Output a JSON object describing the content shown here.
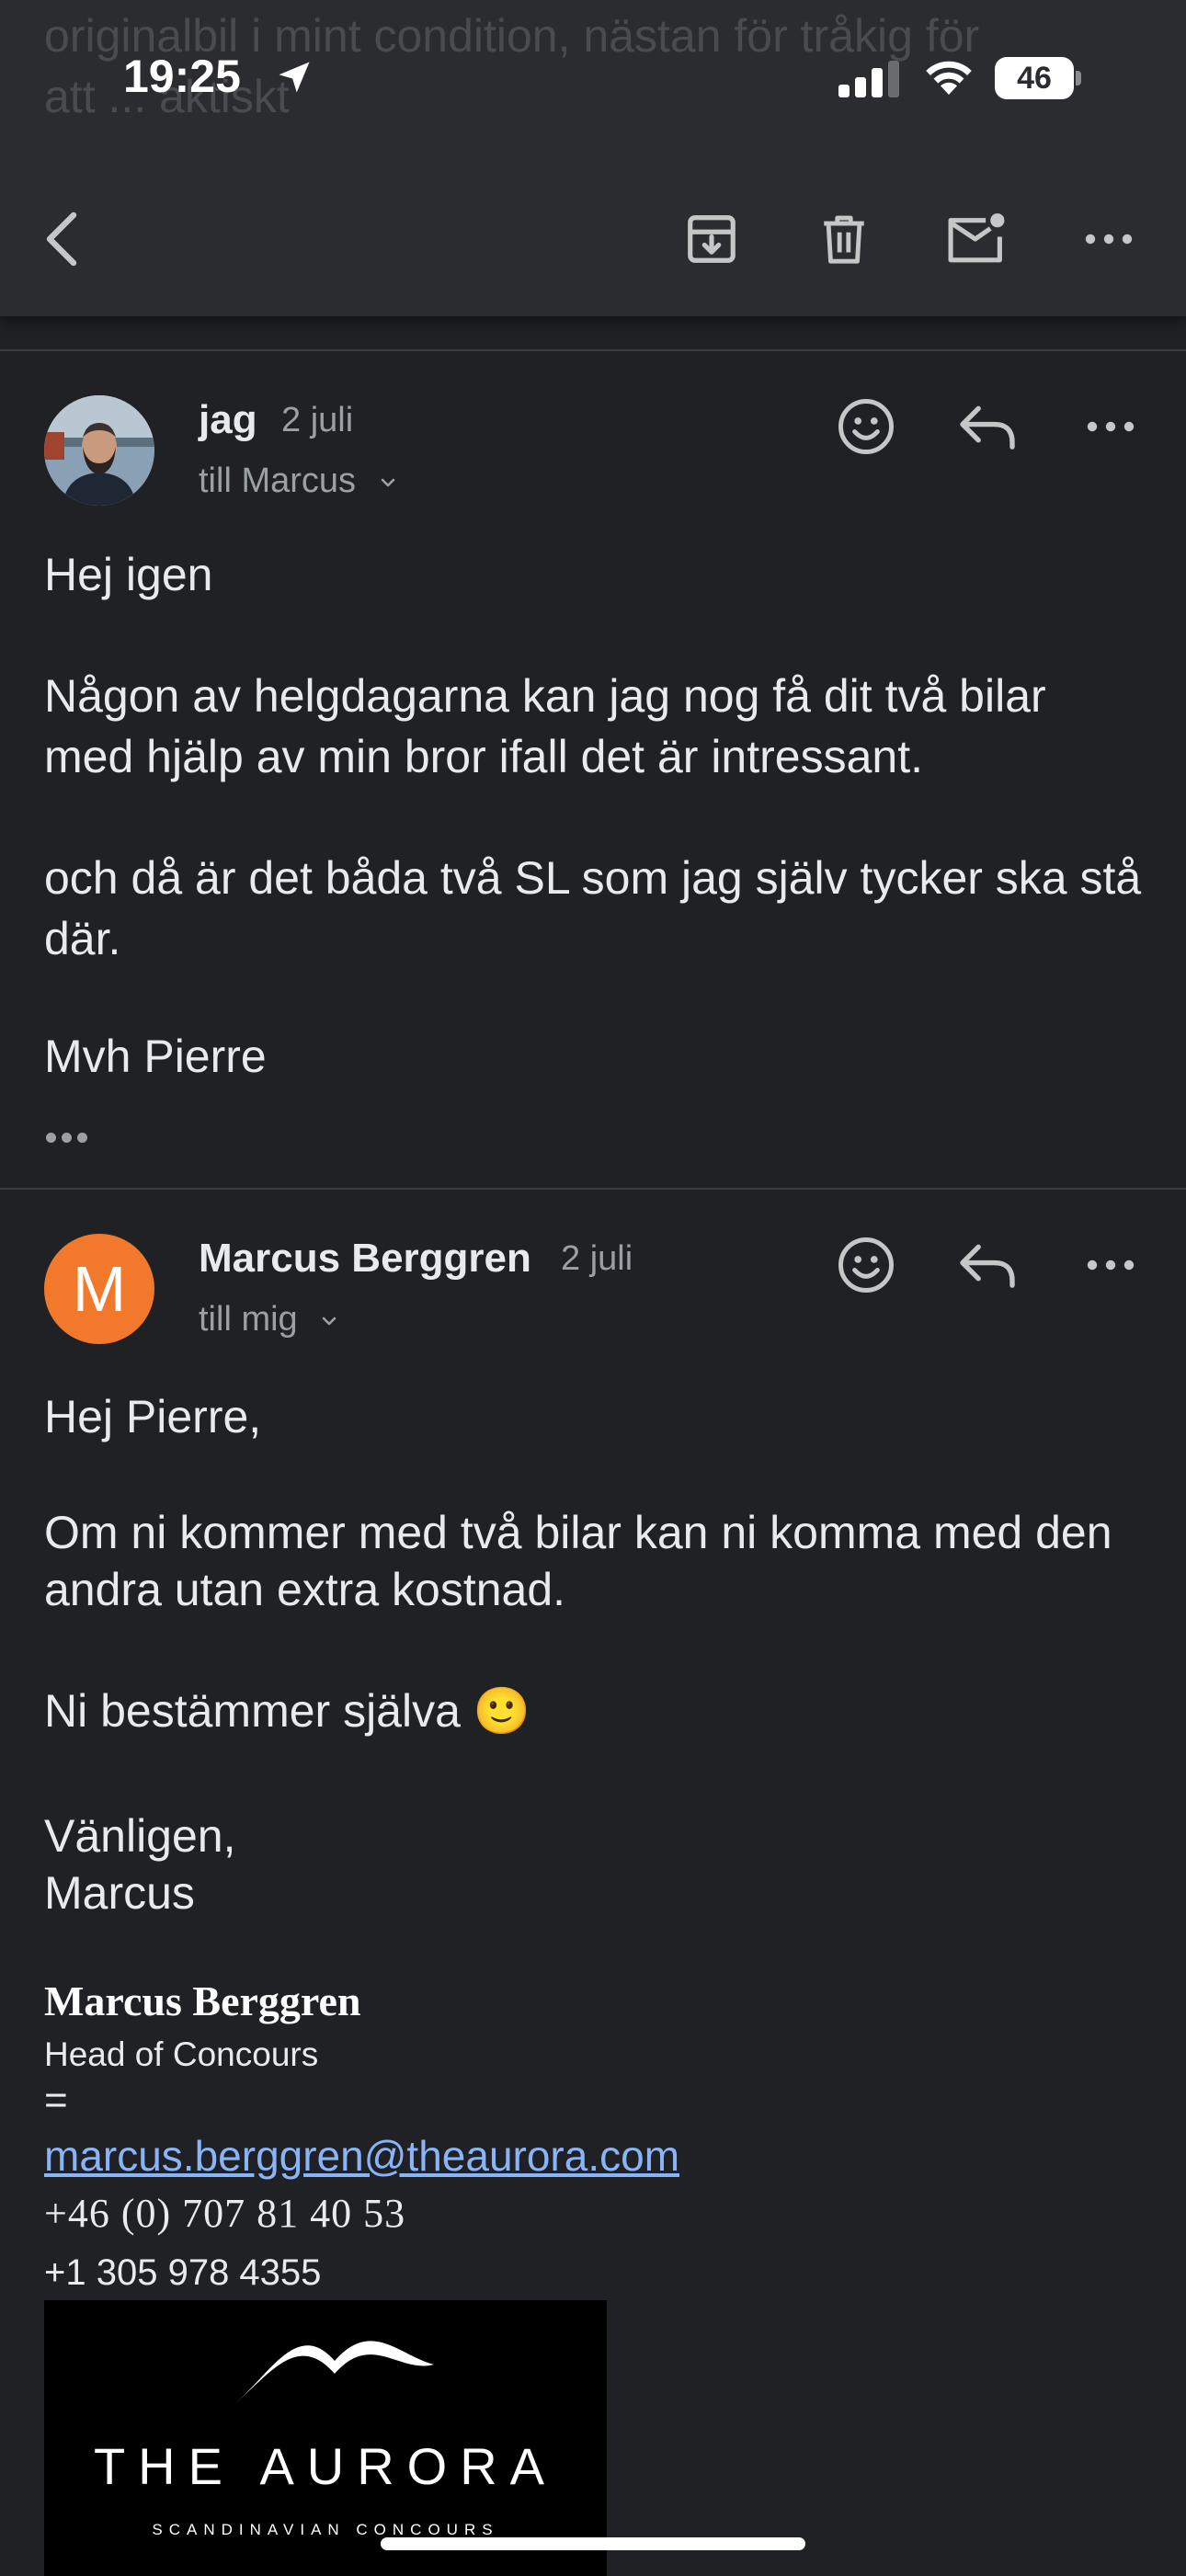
{
  "status_bar": {
    "time": "19:25",
    "battery": "46"
  },
  "background_text": "originalbil i mint condition, nästan för tråkig för\natt ... aktiskt",
  "toolbar": {
    "back_icon": "chevron-left-icon",
    "archive_icon": "archive-icon",
    "delete_icon": "trash-icon",
    "mark_unread_icon": "mail-unread-icon",
    "more_icon": "more-horizontal-icon"
  },
  "messages": [
    {
      "sender": "jag",
      "date": "2 juli",
      "recipient": "till Marcus",
      "body": [
        "Hej igen",
        "Någon av helgdagarna kan jag nog få dit två bilar med hjälp av min bror ifall det är intressant.",
        "och då är det båda två SL som jag själv tycker ska stå där.",
        "Mvh Pierre"
      ]
    },
    {
      "sender": "Marcus Berggren",
      "avatar_letter": "M",
      "avatar_color": "#f2792b",
      "date": "2 juli",
      "recipient": "till mig",
      "body": [
        "Hej Pierre,",
        "Om ni kommer med två bilar kan ni komma med den andra utan extra kostnad.",
        "Ni bestämmer själva 🙂",
        "Vänligen,\nMarcus"
      ],
      "signature": {
        "name": "Marcus Berggren",
        "title": "Head of Concours",
        "separator": "=",
        "email": "marcus.berggren@theaurora.com",
        "phone1": "+46 (0) 707 81 40 53",
        "phone2": "+1 305 978 4355",
        "logo_name": "THE AURORA",
        "logo_sub": "SCANDINAVIAN CONCOURS"
      }
    }
  ],
  "colors": {
    "background": "#202124",
    "toolbar": "#2b2c2f",
    "link": "#8ab4f8",
    "secondary_text": "#9aa0a6"
  }
}
